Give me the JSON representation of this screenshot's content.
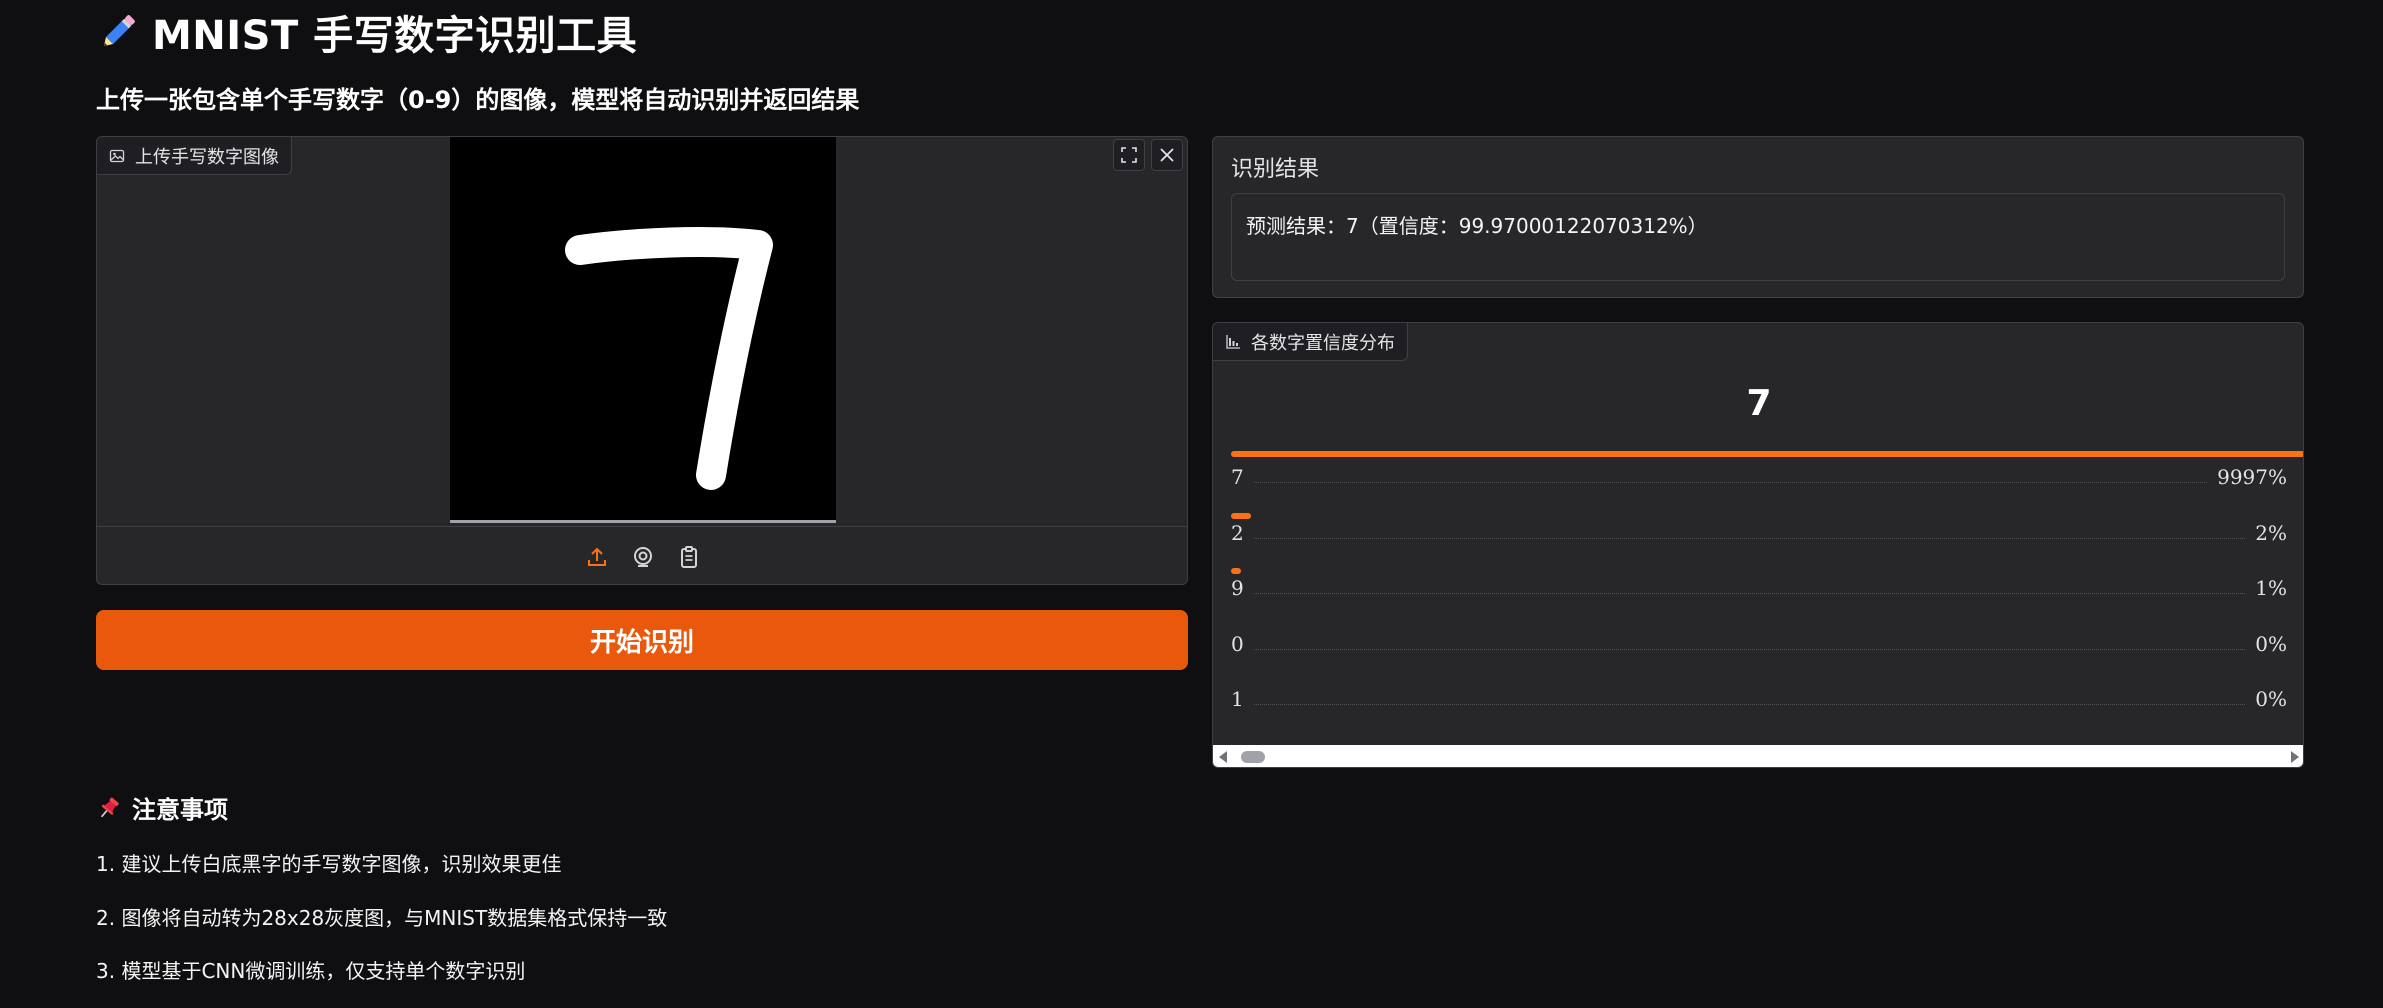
{
  "page": {
    "title": "MNIST 手写数字识别工具",
    "subtitle": "上传一张包含单个手写数字（0-9）的图像，模型将自动识别并返回结果",
    "title_icon": "pencil-icon",
    "accent_color": "#ea580c"
  },
  "upload": {
    "label": "上传手写数字图像",
    "image_icon": "image-icon",
    "controls": [
      "fullscreen-icon",
      "close-icon"
    ],
    "tools": [
      "upload-icon",
      "webcam-icon",
      "clipboard-icon"
    ]
  },
  "actions": {
    "start_label": "开始识别"
  },
  "result": {
    "label": "识别结果",
    "text": "预测结果：7（置信度：99.97000122070312%）"
  },
  "confidence": {
    "label": "各数字置信度分布",
    "top_label": "7",
    "rows": [
      {
        "digit": "7",
        "pct": "9997%",
        "fraction": 1.0
      },
      {
        "digit": "2",
        "pct": "2%",
        "fraction": 0.02
      },
      {
        "digit": "9",
        "pct": "1%",
        "fraction": 0.01
      },
      {
        "digit": "0",
        "pct": "0%",
        "fraction": 0
      },
      {
        "digit": "1",
        "pct": "0%",
        "fraction": 0
      }
    ]
  },
  "notes": {
    "title": "注意事项",
    "icon": "pushpin-icon",
    "items": [
      "1. 建议上传白底黑字的手写数字图像，识别效果更佳",
      "2. 图像将自动转为28x28灰度图，与MNIST数据集格式保持一致",
      "3. 模型基于CNN微调训练，仅支持单个数字识别"
    ]
  }
}
